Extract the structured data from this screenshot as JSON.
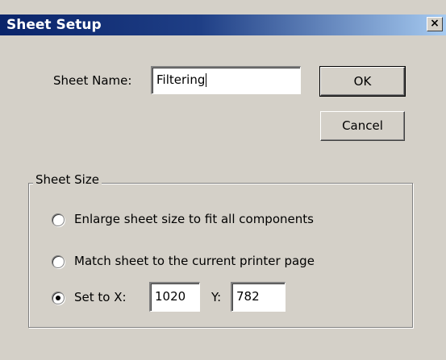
{
  "window": {
    "title": "Sheet Setup",
    "close_glyph": "×"
  },
  "sheet_name": {
    "label": "Sheet Name:",
    "value": "Filtering"
  },
  "buttons": {
    "ok": "OK",
    "cancel": "Cancel"
  },
  "sheet_size": {
    "group_label": "Sheet Size",
    "options": [
      {
        "label": "Enlarge sheet size to fit all components",
        "selected": false
      },
      {
        "label": "Match sheet to the current printer page",
        "selected": false
      },
      {
        "label": "Set to X:",
        "selected": true
      }
    ],
    "x_value": "1020",
    "y_label": "Y:",
    "y_value": "782"
  }
}
